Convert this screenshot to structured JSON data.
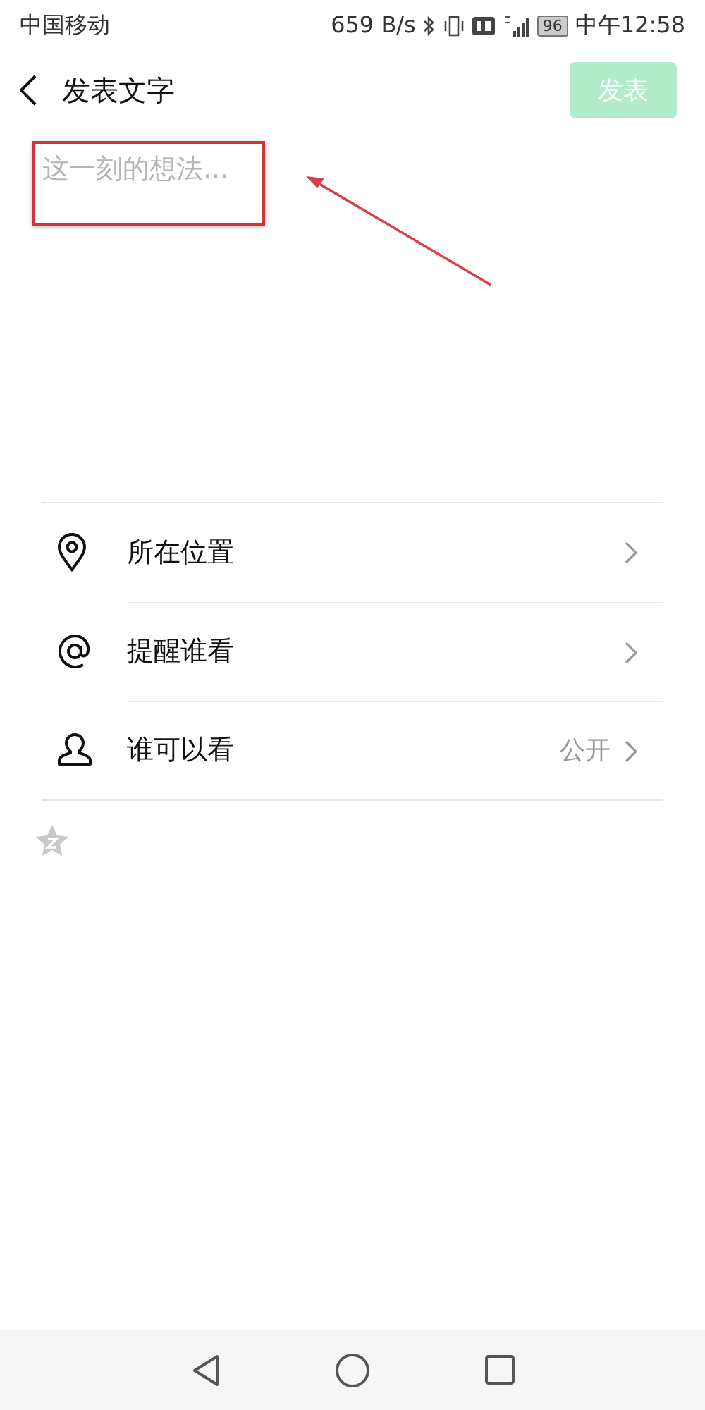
{
  "status_bar": {
    "carrier": "中国移动",
    "speed": "659 B/s",
    "battery": "96",
    "time": "中午12:58"
  },
  "header": {
    "title": "发表文字",
    "publish_button": {
      "label": "发表",
      "disabled": true
    }
  },
  "post_field": {
    "placeholder": "这一刻的想法..."
  },
  "options": [
    {
      "label": "所在位置"
    },
    {
      "label": "提醒谁看"
    },
    {
      "label": "谁可以看",
      "value": "公开"
    }
  ]
}
